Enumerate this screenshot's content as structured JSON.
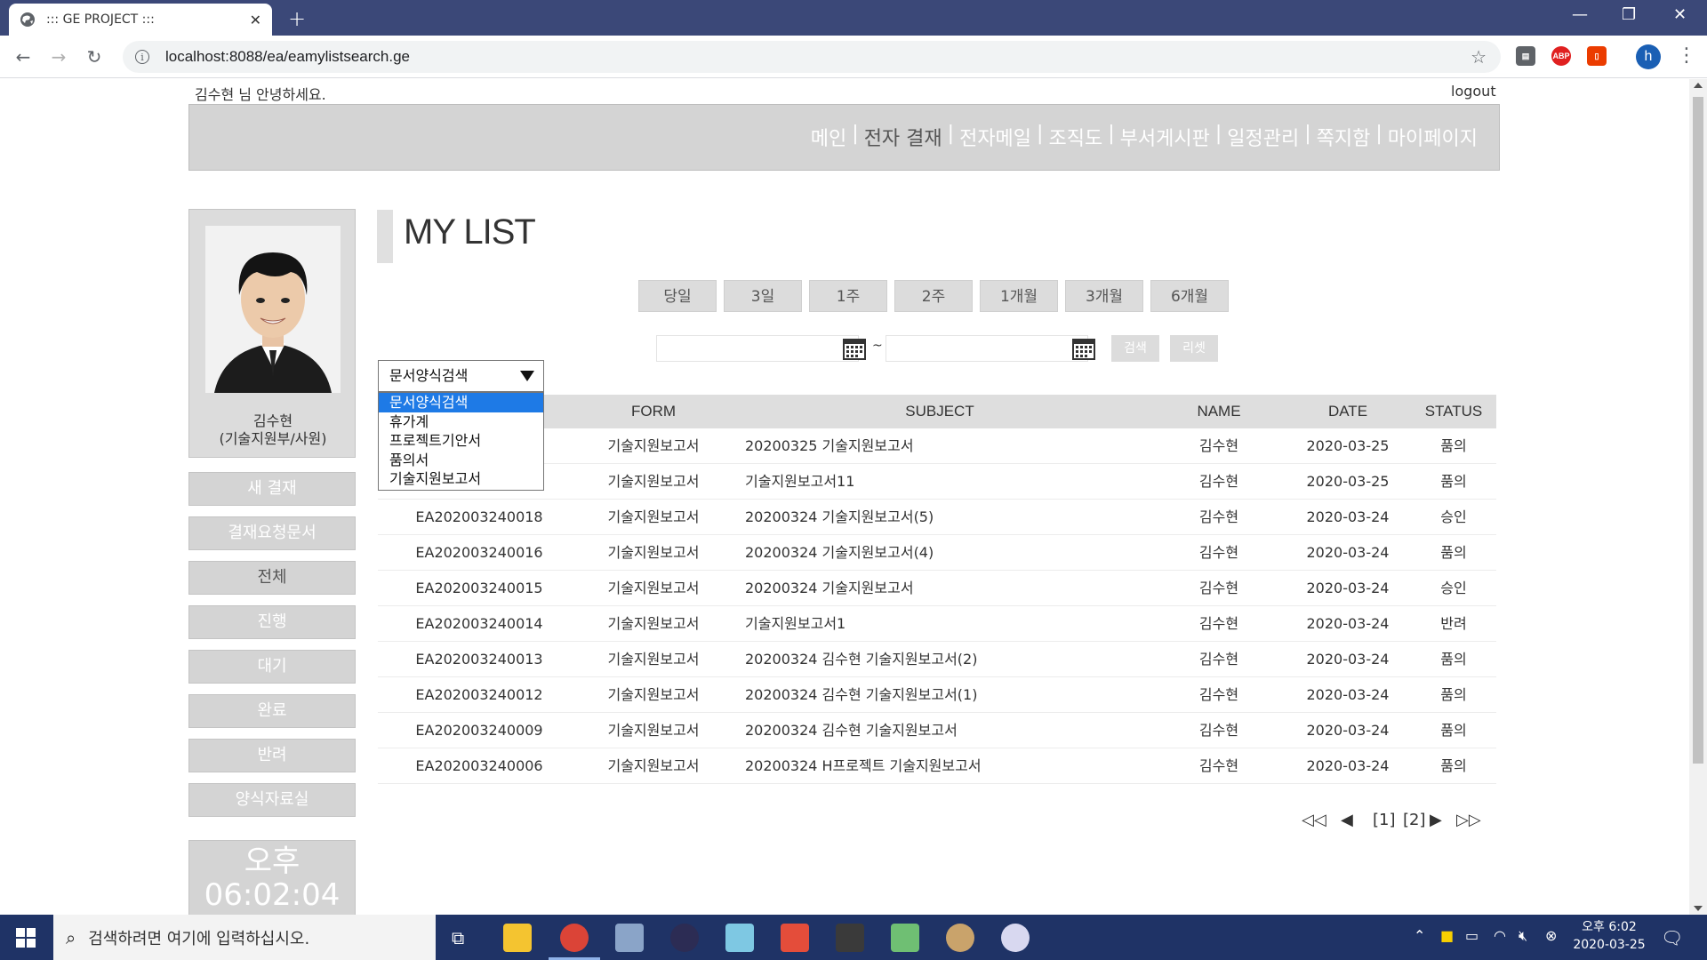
{
  "browser": {
    "tab_title": "::: GE PROJECT :::",
    "tab_close": "✕",
    "new_tab": "+",
    "url": "localhost:8088/ea/eamylistsearch.ge",
    "window_controls": [
      "—",
      "❐",
      "✕"
    ],
    "profile_initial": "h",
    "extensions": [
      "ext-icon",
      "abp-icon",
      "office-icon"
    ]
  },
  "header": {
    "greeting": "김수현 님 안녕하세요.",
    "logout": "logout"
  },
  "topnav": {
    "items": [
      {
        "label": "메인"
      },
      {
        "label": "전자 결재"
      },
      {
        "label": "전자메일"
      },
      {
        "label": "조직도"
      },
      {
        "label": "부서게시판"
      },
      {
        "label": "일정관리"
      },
      {
        "label": "쪽지함"
      },
      {
        "label": "마이페이지"
      }
    ],
    "separator": "|"
  },
  "profile": {
    "name": "김수현",
    "dept": "(기술지원부/사원)"
  },
  "sidebar": {
    "items": [
      {
        "label": "새 결재"
      },
      {
        "label": "결재요청문서"
      },
      {
        "label": "전체"
      },
      {
        "label": "진행"
      },
      {
        "label": "대기"
      },
      {
        "label": "완료"
      },
      {
        "label": "반려"
      },
      {
        "label": "양식자료실"
      }
    ]
  },
  "clock": {
    "ampm": "오후",
    "time": "06:02:04"
  },
  "main": {
    "title": "MY LIST",
    "periods": [
      "당일",
      "3일",
      "1주",
      "2주",
      "1개월",
      "3개월",
      "6개월"
    ],
    "date_separator": "~",
    "search_label": "검색",
    "reset_label": "리셋",
    "form_select": {
      "selected": "문서양식검색",
      "options": [
        "문서양식검색",
        "휴가계",
        "프로젝트기안서",
        "품의서",
        "기술지원보고서"
      ]
    },
    "table": {
      "columns": [
        "FORM",
        "SUBJECT",
        "NAME",
        "DATE",
        "STATUS"
      ],
      "rows": [
        {
          "no": "",
          "form": "기술지원보고서",
          "subject": "20200325 기술지원보고서",
          "name": "김수현",
          "date": "2020-03-25",
          "status": "품의"
        },
        {
          "no": "",
          "form": "기술지원보고서",
          "subject": "기술지원보고서11",
          "name": "김수현",
          "date": "2020-03-25",
          "status": "품의"
        },
        {
          "no": "EA202003240018",
          "form": "기술지원보고서",
          "subject": "20200324 기술지원보고서(5)",
          "name": "김수현",
          "date": "2020-03-24",
          "status": "승인"
        },
        {
          "no": "EA202003240016",
          "form": "기술지원보고서",
          "subject": "20200324 기술지원보고서(4)",
          "name": "김수현",
          "date": "2020-03-24",
          "status": "품의"
        },
        {
          "no": "EA202003240015",
          "form": "기술지원보고서",
          "subject": "20200324 기술지원보고서",
          "name": "김수현",
          "date": "2020-03-24",
          "status": "승인"
        },
        {
          "no": "EA202003240014",
          "form": "기술지원보고서",
          "subject": "기술지원보고서1",
          "name": "김수현",
          "date": "2020-03-24",
          "status": "반려"
        },
        {
          "no": "EA202003240013",
          "form": "기술지원보고서",
          "subject": "20200324 김수현 기술지원보고서(2)",
          "name": "김수현",
          "date": "2020-03-24",
          "status": "품의"
        },
        {
          "no": "EA202003240012",
          "form": "기술지원보고서",
          "subject": "20200324 김수현 기술지원보고서(1)",
          "name": "김수현",
          "date": "2020-03-24",
          "status": "품의"
        },
        {
          "no": "EA202003240009",
          "form": "기술지원보고서",
          "subject": "20200324 김수현 기술지원보고서",
          "name": "김수현",
          "date": "2020-03-24",
          "status": "품의"
        },
        {
          "no": "EA202003240006",
          "form": "기술지원보고서",
          "subject": "20200324 H프로젝트 기술지원보고서",
          "name": "김수현",
          "date": "2020-03-24",
          "status": "품의"
        }
      ]
    },
    "pager": {
      "first": "◁◁",
      "prev": "◀",
      "pages": [
        "[1]",
        "[2]"
      ],
      "next": "▶",
      "last": "▷▷"
    }
  },
  "taskbar": {
    "search_placeholder": "검색하려면 여기에 입력하십시오.",
    "time": "오후 6:02",
    "date": "2020-03-25"
  },
  "colors": {
    "tabstrip": "#3b4878",
    "taskbar": "#1f3366",
    "nav_gray": "#d4d4d4",
    "select_highlight": "#1e7ae6"
  }
}
